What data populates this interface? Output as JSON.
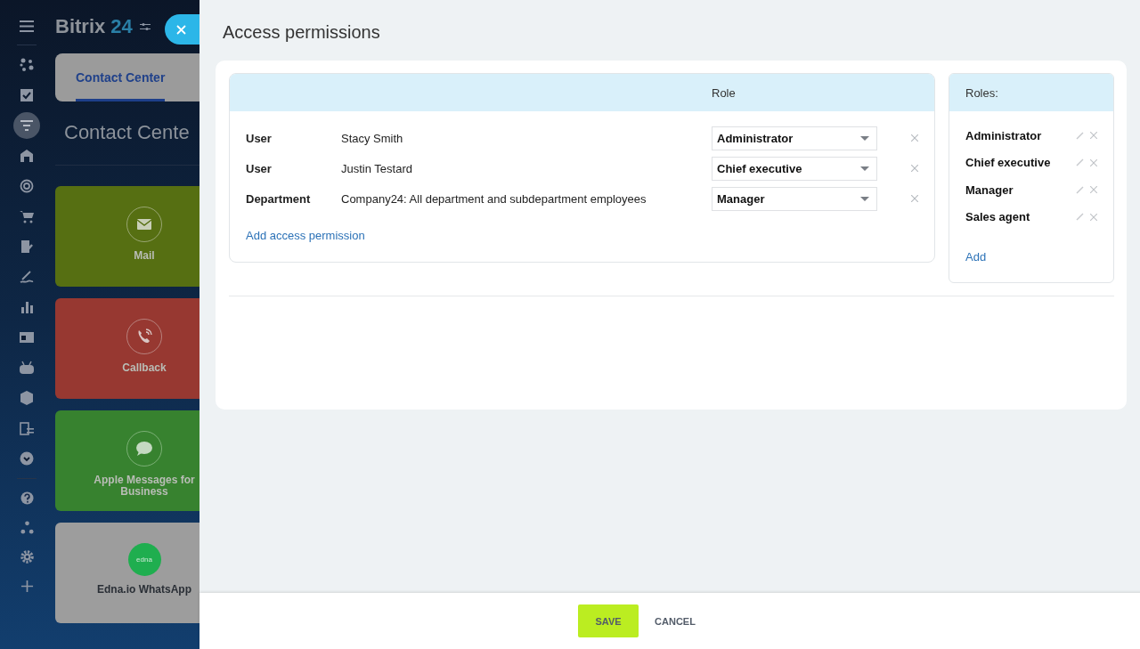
{
  "app": {
    "logo": "Bitrix",
    "logo_number": "24",
    "tab": {
      "label": "Contact Center",
      "selected": true
    },
    "heading": "Contact Cente",
    "tiles": [
      {
        "label": "Mail",
        "color": "#566f12",
        "kind": "mail"
      },
      {
        "label": "Callback",
        "color": "#973831",
        "kind": "phone"
      },
      {
        "label": "Apple Messages for Business",
        "color": "#37822f",
        "kind": "chat"
      },
      {
        "label": "Edna.io WhatsApp",
        "color": "#9d9d9d",
        "kind": "logo",
        "logo_text": "edna"
      }
    ]
  },
  "panel": {
    "title": "Access permissions",
    "permissions": {
      "column": "Role",
      "rows": [
        {
          "type": "User",
          "name": "Stacy Smith",
          "role": "Administrator"
        },
        {
          "type": "User",
          "name": "Justin Testard",
          "role": "Chief executive"
        },
        {
          "type": "Department",
          "name": "Company24: All department and subdepartment employees",
          "role": "Manager"
        }
      ],
      "add_link": "Add access permission"
    },
    "roles": {
      "title": "Roles:",
      "items": [
        "Administrator",
        "Chief executive",
        "Manager",
        "Sales agent"
      ],
      "add_link": "Add"
    },
    "buttons": {
      "save": "SAVE",
      "cancel": "CANCEL"
    }
  }
}
